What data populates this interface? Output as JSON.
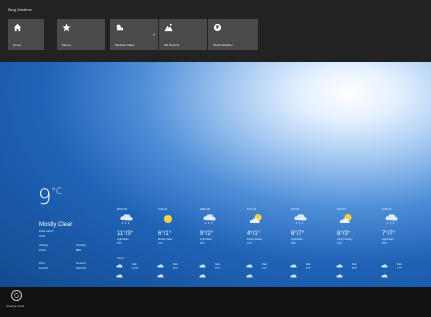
{
  "app": {
    "title": "Bing Weather"
  },
  "nav": [
    {
      "label": "Home",
      "icon": "home-icon"
    },
    {
      "label": "Places",
      "icon": "star-icon"
    },
    {
      "label": "Weather Maps",
      "icon": "weather-maps-icon"
    },
    {
      "label": "Ski Resorts",
      "icon": "mountain-icon"
    },
    {
      "label": "World Weather",
      "icon": "globe-icon"
    }
  ],
  "current": {
    "temp": "9",
    "unit": "°C",
    "condition": "Mostly Clear",
    "feels": "Feels Like 8°",
    "time": "18:01",
    "details": [
      {
        "label": "Visibility",
        "value": "10 km"
      },
      {
        "label": "Humidity",
        "value": "86%"
      },
      {
        "label": "Wind",
        "value": "12 km/h"
      },
      {
        "label": "Pressure",
        "value": "1012 mb"
      }
    ]
  },
  "forecast": [
    {
      "day": "MON 18",
      "temps": "11°/3°",
      "condition": "Light Rain",
      "precip": "80%",
      "icon": "rain-cloud-icon"
    },
    {
      "day": "TUE 19",
      "temps": "6°/1°",
      "condition": "Mostly Clear",
      "precip": "10%",
      "icon": "sun-icon"
    },
    {
      "day": "WED 20",
      "temps": "9°/2°",
      "condition": "Light Rain",
      "precip": "80%",
      "icon": "rain-cloud-icon"
    },
    {
      "day": "THU 21",
      "temps": "4°/1°",
      "condition": "Partly Cloudy",
      "precip": "10%",
      "icon": "partly-cloudy-icon"
    },
    {
      "day": "FRI 22",
      "temps": "8°/7°",
      "condition": "Light Rain",
      "precip": "80%",
      "icon": "rain-cloud-icon"
    },
    {
      "day": "SAT 23",
      "temps": "8°/3°",
      "condition": "Partly Cloudy",
      "precip": "10%",
      "icon": "partly-cloudy-icon"
    },
    {
      "day": "SUN 24",
      "temps": "7°/7°",
      "condition": "Light Rain",
      "precip": "80%",
      "icon": "rain-cloud-icon"
    }
  ],
  "hourly_header": "Hourly",
  "hourly": [
    {
      "a": "Rain",
      "b": "12°/6°"
    },
    {
      "a": "Rain",
      "b": "6°/1°"
    },
    {
      "a": "Rain",
      "b": "9°/2°"
    },
    {
      "a": "Rain",
      "b": "4°/1°"
    },
    {
      "a": "Rain",
      "b": "8°/7°"
    },
    {
      "a": "Rain",
      "b": "8°/3°"
    },
    {
      "a": "Rain",
      "b": "7°/7°"
    }
  ],
  "bottom": {
    "change_label": "Change Units",
    "icon": "change-units-icon"
  }
}
